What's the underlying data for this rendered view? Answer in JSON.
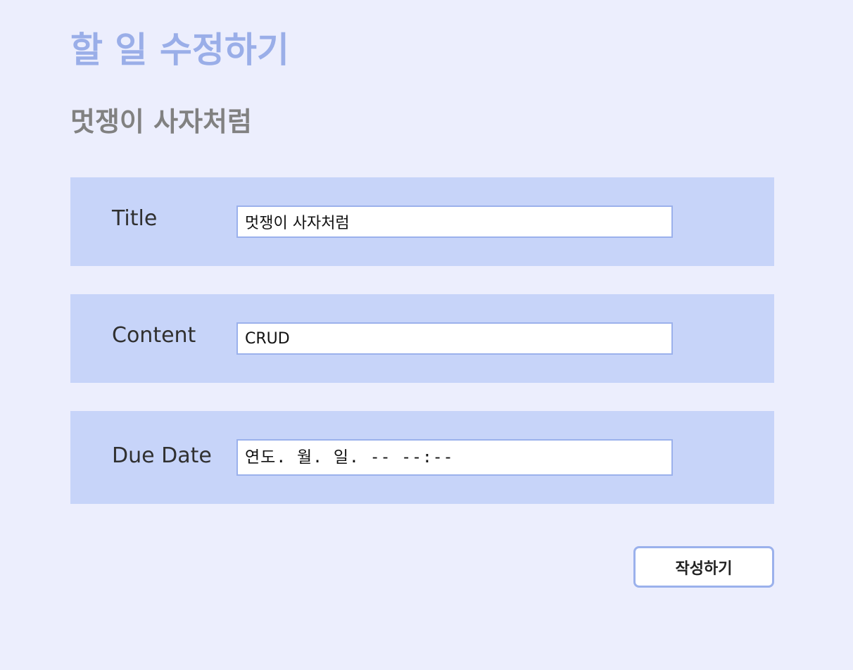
{
  "page": {
    "title": "할 일 수정하기",
    "todo_heading": "멋쟁이 사자처럼"
  },
  "form": {
    "title_field": {
      "label": "Title",
      "value": "멋쟁이 사자처럼"
    },
    "content_field": {
      "label": "Content",
      "value": "CRUD"
    },
    "due_date_field": {
      "label": "Due Date",
      "display": "연도. 월. 일. -- --:--"
    },
    "submit_label": "작성하기"
  },
  "colors": {
    "background": "#eceefd",
    "title_accent": "#9aaee8",
    "row_background": "#c7d4f9",
    "field_border": "#9bb1ec"
  }
}
